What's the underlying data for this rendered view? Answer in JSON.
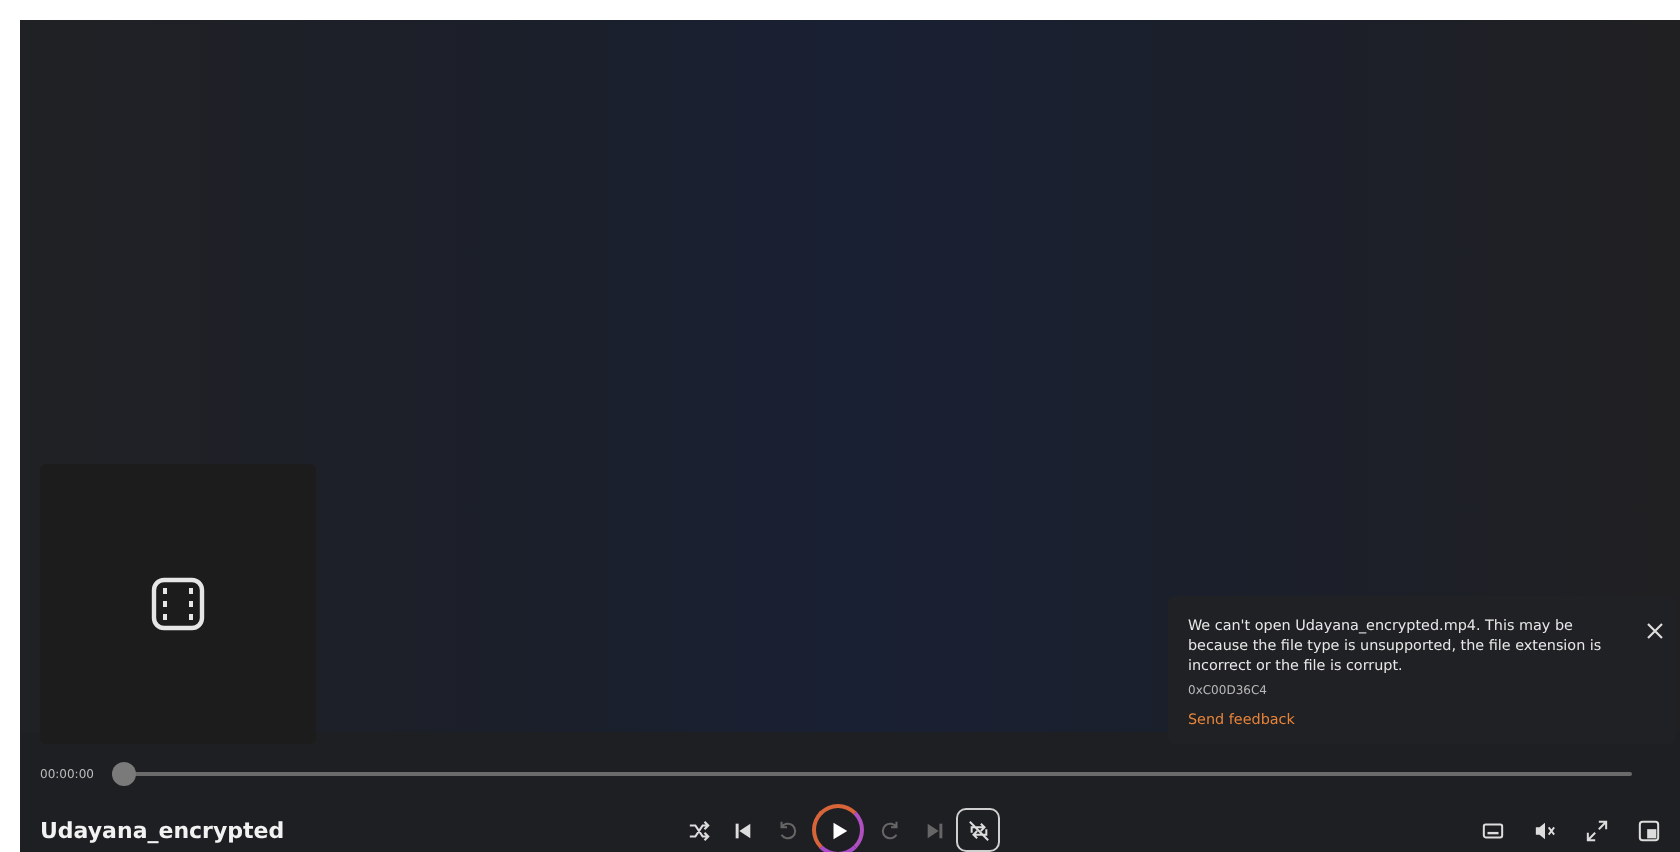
{
  "player": {
    "title": "Udayana_encrypted",
    "time": "00:00:00",
    "progress": {
      "level": 0
    }
  },
  "error_toast": {
    "message": "We can't open Udayana_encrypted.mp4. This may be because the file type is unsupported, the file extension is incorrect or the file is corrupt.",
    "code": "0xC00D36C4",
    "link": "Send feedback"
  },
  "controls": [
    {
      "kind": "shuffle",
      "disabled": false,
      "on": false
    },
    {
      "kind": "previous",
      "disabled": false,
      "on": false
    },
    {
      "kind": "rewind",
      "disabled": true,
      "on": false
    },
    {
      "kind": "play",
      "disabled": false,
      "on": false
    },
    {
      "kind": "forward",
      "disabled": true,
      "on": false
    },
    {
      "kind": "next",
      "disabled": true,
      "on": false
    },
    {
      "kind": "repeat",
      "disabled": false,
      "on": true
    }
  ],
  "right_controls": [
    {
      "kind": "captions"
    },
    {
      "kind": "volume"
    },
    {
      "kind": "fullscreen"
    },
    {
      "kind": "miniplayer"
    }
  ]
}
